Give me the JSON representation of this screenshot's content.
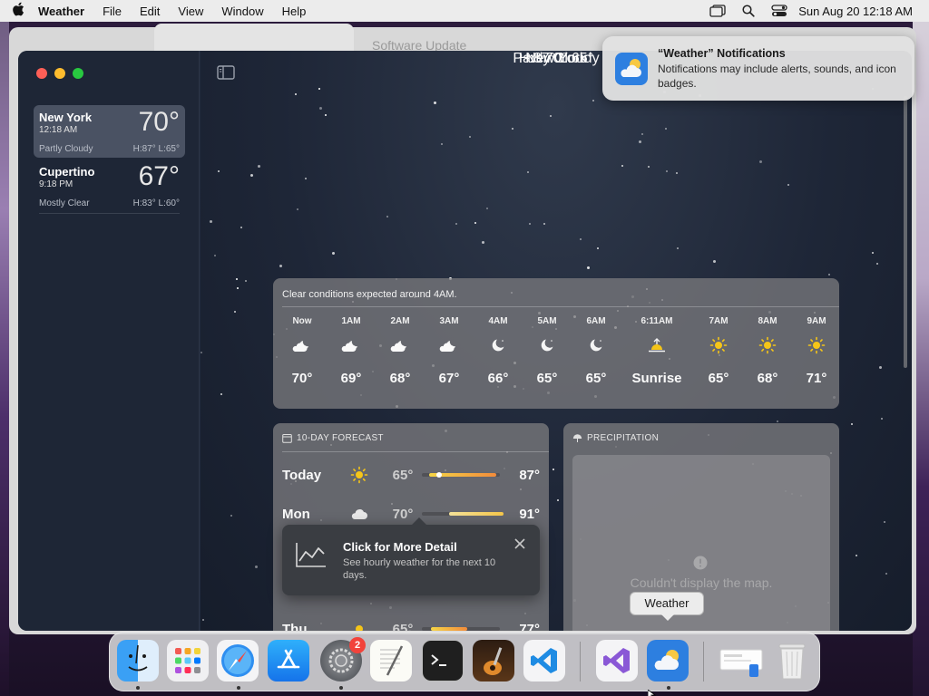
{
  "menubar": {
    "app_name": "Weather",
    "menus": [
      "File",
      "Edit",
      "View",
      "Window",
      "Help"
    ],
    "clock": "Sun Aug 20  12:18 AM"
  },
  "background_window": {
    "title": "Software Update"
  },
  "sidebar": {
    "cities": [
      {
        "name": "New York",
        "time": "12:18 AM",
        "temp": "70°",
        "condition": "Partly Cloudy",
        "hilo": "H:87°  L:65°",
        "selected": true
      },
      {
        "name": "Cupertino",
        "time": "9:18 PM",
        "temp": "67°",
        "condition": "Mostly Clear",
        "hilo": "H:83°  L:60°",
        "selected": false
      }
    ]
  },
  "current": {
    "city": "New York",
    "temp": "70°",
    "condition": "Partly Cloudy",
    "hilo": "H:87°  L:65°"
  },
  "hourly": {
    "caption": "Clear conditions expected around 4AM.",
    "hours": [
      {
        "label": "Now",
        "icon": "partly-cloudy-night-icon",
        "temp": "70°"
      },
      {
        "label": "1AM",
        "icon": "partly-cloudy-night-icon",
        "temp": "69°"
      },
      {
        "label": "2AM",
        "icon": "partly-cloudy-night-icon",
        "temp": "68°"
      },
      {
        "label": "3AM",
        "icon": "partly-cloudy-night-icon",
        "temp": "67°"
      },
      {
        "label": "4AM",
        "icon": "moon-icon",
        "temp": "66°"
      },
      {
        "label": "5AM",
        "icon": "moon-icon",
        "temp": "65°"
      },
      {
        "label": "6AM",
        "icon": "moon-icon",
        "temp": "65°"
      },
      {
        "label": "6:11AM",
        "icon": "sunrise-icon",
        "temp": "Sunrise"
      },
      {
        "label": "7AM",
        "icon": "sun-icon",
        "temp": "65°"
      },
      {
        "label": "8AM",
        "icon": "sun-icon",
        "temp": "68°"
      },
      {
        "label": "9AM",
        "icon": "sun-icon",
        "temp": "71°"
      }
    ]
  },
  "tenday": {
    "header": "10-DAY FORECAST",
    "days": [
      {
        "day": "Today",
        "icon": "sun-icon",
        "lo": "65°",
        "hi": "87°"
      },
      {
        "day": "Mon",
        "icon": "cloud-icon",
        "lo": "70°",
        "hi": "91°"
      },
      {
        "day": "Thu",
        "icon": "sun-icon",
        "lo": "65°",
        "hi": "77°"
      }
    ]
  },
  "popover": {
    "title": "Click for More Detail",
    "subtitle": "See hourly weather for the next 10 days."
  },
  "precipitation": {
    "header": "PRECIPITATION",
    "message": "Couldn't display the map."
  },
  "notification": {
    "title": "“Weather” Notifications",
    "body": "Notifications may include alerts, sounds, and icon badges."
  },
  "dock": {
    "tooltip": "Weather",
    "settings_badge": "2"
  },
  "colors": {
    "accent_sun": "#f5c518",
    "bar_start": "#f5d547",
    "bar_end": "#f28b3b"
  }
}
